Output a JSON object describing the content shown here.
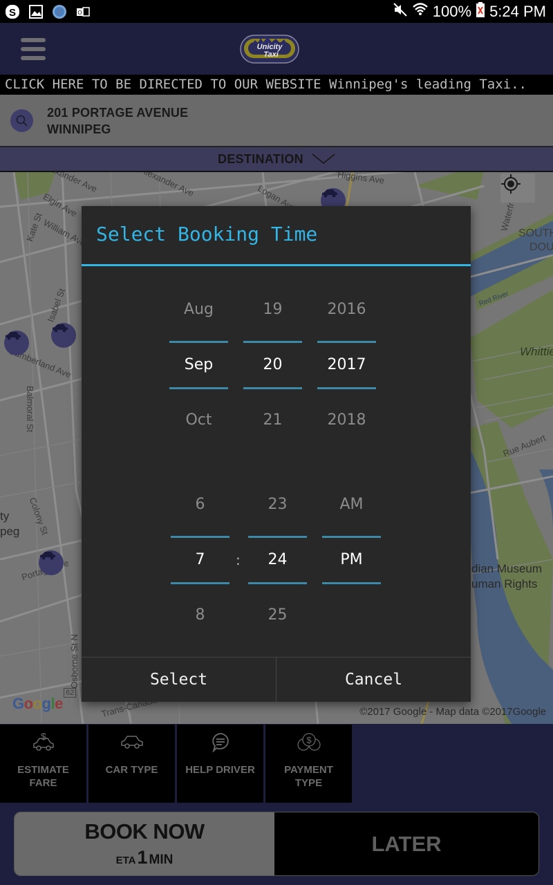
{
  "status_bar": {
    "notification_icons": [
      "skype-icon",
      "gallery-icon",
      "browser-icon",
      "outlook-icon"
    ],
    "battery": "100%",
    "time": "5:24 PM"
  },
  "app_bar": {
    "logo_text_top": "Unicity",
    "logo_text_bottom": "Taxi"
  },
  "ticker": {
    "text": "CLICK HERE TO BE DIRECTED TO OUR WEBSITE Winnipeg's leading Taxi.."
  },
  "pickup": {
    "line1": "201 PORTAGE AVENUE",
    "line2": "WINNIPEG"
  },
  "destination": {
    "label": "DESTINATION"
  },
  "map": {
    "labels": [
      "Higgins Ave",
      "Alexander Ave",
      "Logan Ave",
      "Elgin Ave",
      "William Ave",
      "Kate St",
      "Isabel St",
      "Cumberland Ave",
      "Balmoral St",
      "Colony St",
      "Portage Ave",
      "Osborne St N",
      "Waterfront Dr",
      "SOUTH",
      "DOU",
      "Red River",
      "Whittier",
      "Rue Aubert",
      "dian Museum",
      "uman Rights",
      "ty",
      "peg",
      "Trans-Canada Hwy",
      "62"
    ],
    "google_logo": "Google",
    "copyright": "©2017 Google - Map data ©2017Google"
  },
  "dialog": {
    "title": "Select Booking Time",
    "date": {
      "month": {
        "prev": "Aug",
        "selected": "Sep",
        "next": "Oct"
      },
      "day": {
        "prev": "19",
        "selected": "20",
        "next": "21"
      },
      "year": {
        "prev": "2016",
        "selected": "2017",
        "next": "2018"
      }
    },
    "time": {
      "hour": {
        "prev": "6",
        "selected": "7",
        "next": "8"
      },
      "separator": ":",
      "minute": {
        "prev": "23",
        "selected": "24",
        "next": "25"
      },
      "ampm": {
        "prev": "AM",
        "selected": "PM",
        "next": ""
      }
    },
    "select_label": "Select",
    "cancel_label": "Cancel"
  },
  "tools": [
    {
      "icon": "estimate-fare-icon",
      "label_line1": "ESTIMATE",
      "label_line2": "FARE"
    },
    {
      "icon": "car-icon",
      "label_line1": "CAR TYPE",
      "label_line2": ""
    },
    {
      "icon": "chat-icon",
      "label_line1": "HELP DRIVER",
      "label_line2": ""
    },
    {
      "icon": "coins-icon",
      "label_line1": "PAYMENT",
      "label_line2": "TYPE"
    }
  ],
  "booking": {
    "book_now_label": "BOOK NOW",
    "eta_prefix": "ETA",
    "eta_value": "1",
    "eta_unit": "MIN",
    "later_label": "LATER"
  },
  "colors": {
    "accent": "#33b5e5",
    "header_bg": "#1e1e3e",
    "picker_divider": "#3b8aa8",
    "dialog_bg": "#282828"
  }
}
